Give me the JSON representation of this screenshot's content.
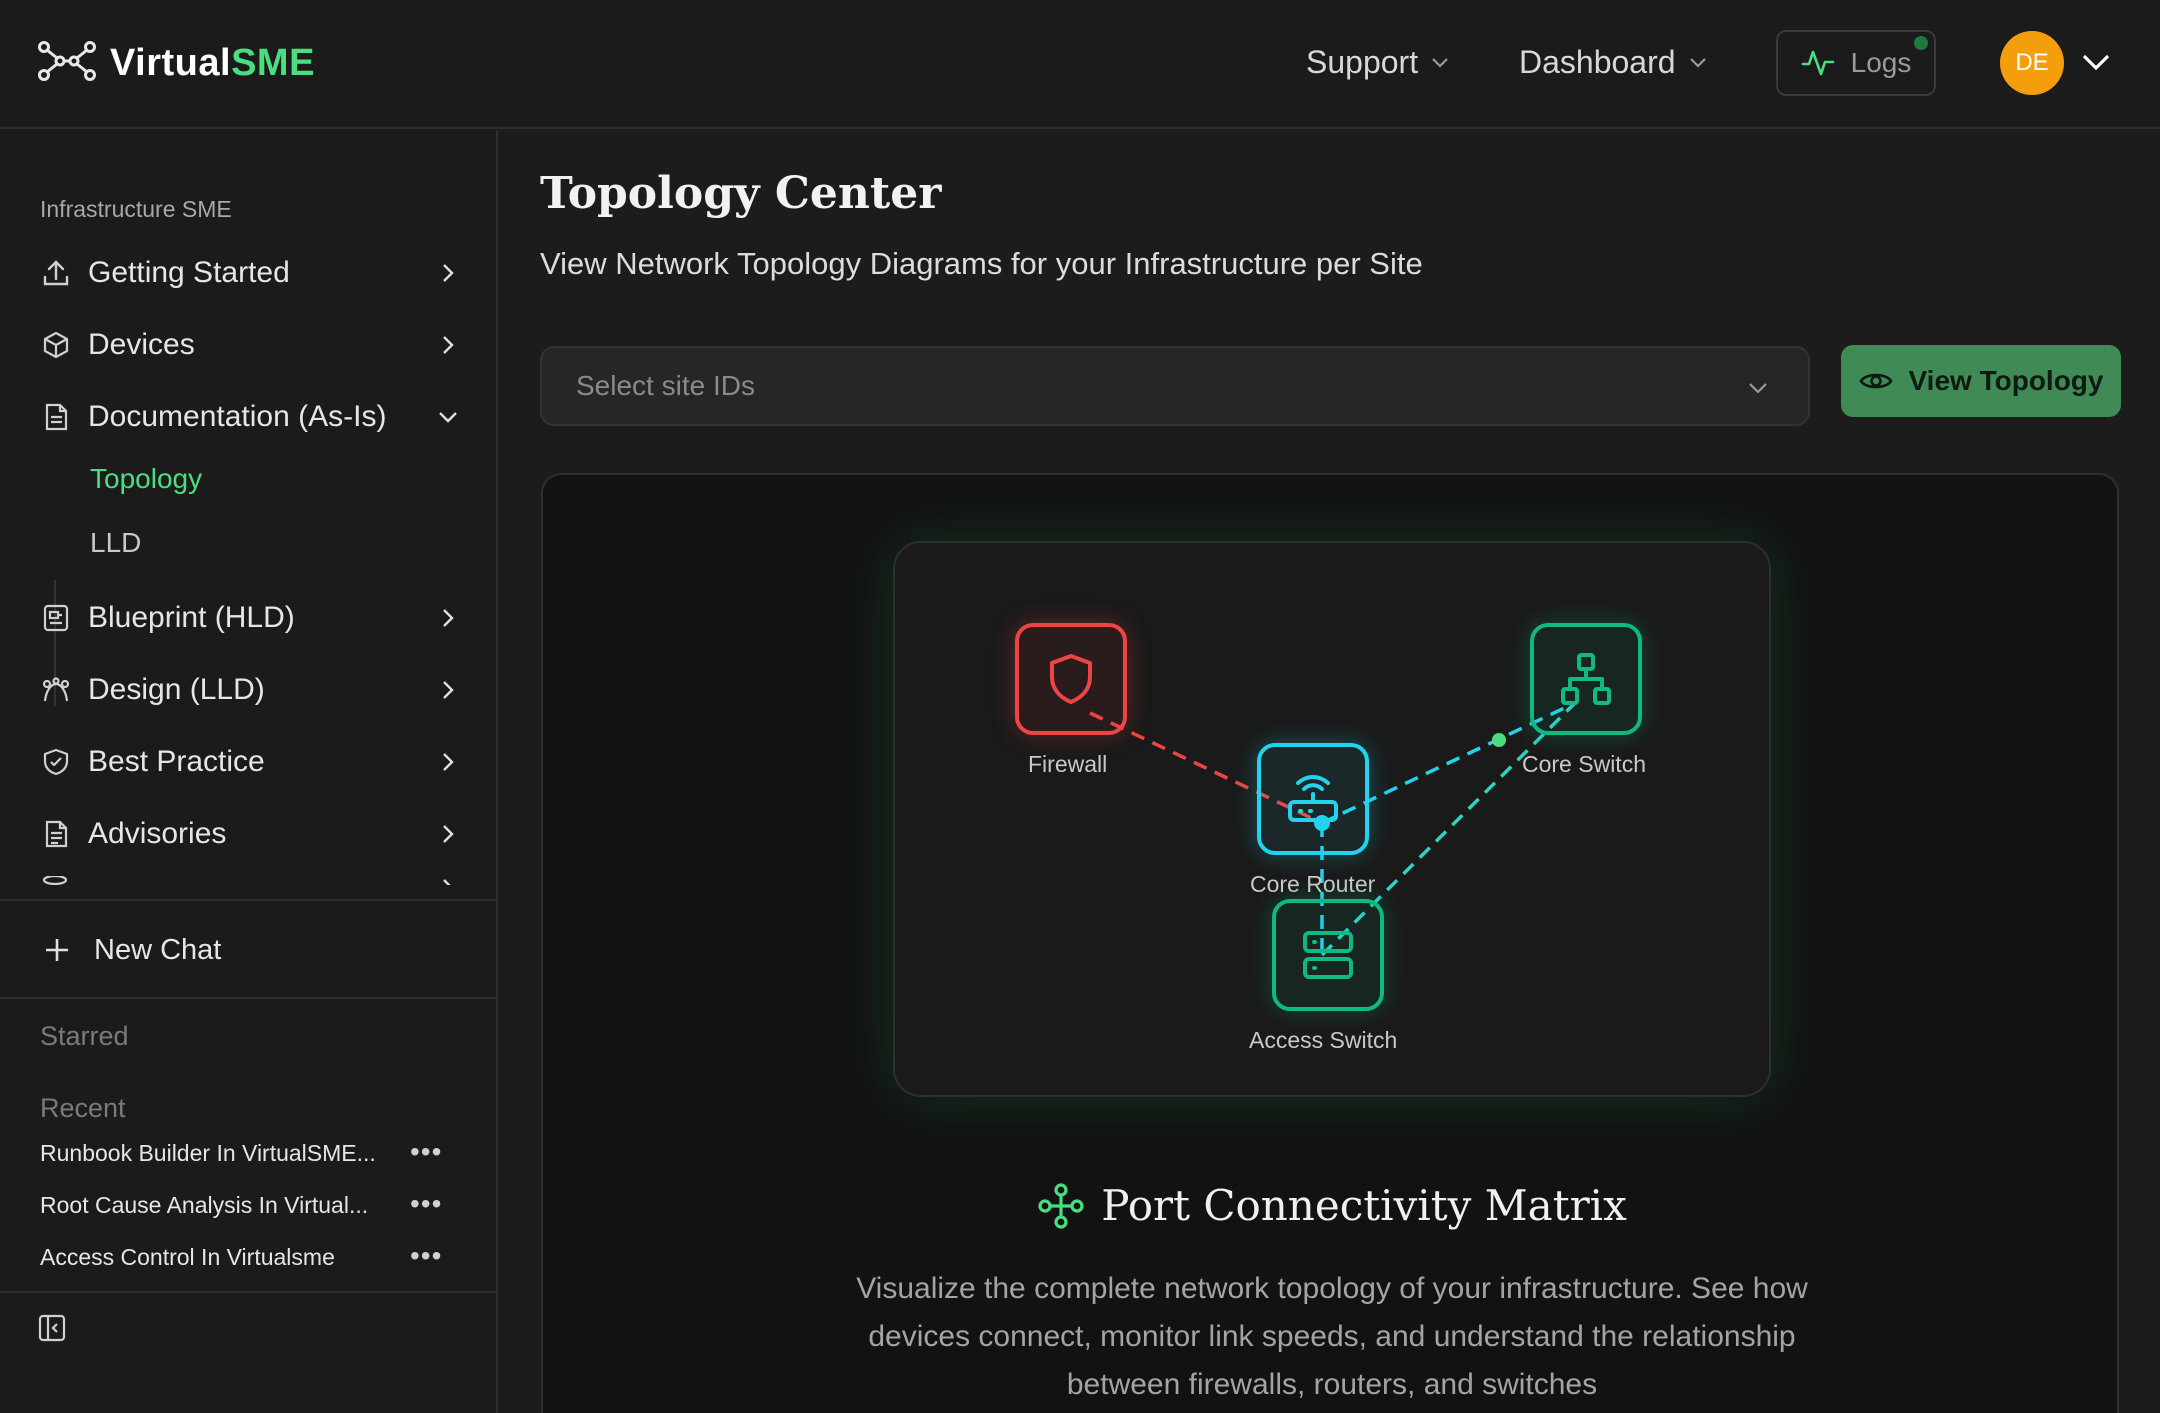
{
  "header": {
    "logo_primary": "Virtual",
    "logo_accent": "SME",
    "nav": [
      {
        "label": "Support"
      },
      {
        "label": "Dashboard"
      }
    ],
    "logs_label": "Logs",
    "avatar_initials": "DE"
  },
  "sidebar": {
    "section_title": "Infrastructure SME",
    "items": [
      {
        "label": "Getting Started",
        "icon": "upload-icon"
      },
      {
        "label": "Devices",
        "icon": "box-icon"
      },
      {
        "label": "Documentation (As-Is)",
        "icon": "document-icon",
        "expanded": true
      },
      {
        "label": "Blueprint (HLD)",
        "icon": "blueprint-icon"
      },
      {
        "label": "Design (LLD)",
        "icon": "bezier-icon"
      },
      {
        "label": "Best Practice",
        "icon": "handshake-icon"
      },
      {
        "label": "Advisories",
        "icon": "file-text-icon"
      }
    ],
    "sub_items": [
      {
        "label": "Topology",
        "active": true
      },
      {
        "label": "LLD",
        "active": false
      }
    ],
    "new_chat_label": "New Chat",
    "starred_label": "Starred",
    "recent_label": "Recent",
    "recent": [
      {
        "title": "Runbook Builder In VirtualSME..."
      },
      {
        "title": "Root Cause Analysis In Virtual..."
      },
      {
        "title": "Access Control In Virtualsme"
      }
    ]
  },
  "main": {
    "title": "Topology Center",
    "subtitle": "View Network Topology Diagrams for your Infrastructure per Site",
    "site_select_placeholder": "Select site IDs",
    "view_button_label": "View Topology",
    "diagram": {
      "nodes": [
        {
          "label": "Firewall",
          "color": "#ef4444"
        },
        {
          "label": "Core Router",
          "color": "#22d3ee"
        },
        {
          "label": "Core Switch",
          "color": "#10b981"
        },
        {
          "label": "Access Switch",
          "color": "#10b981"
        }
      ]
    },
    "connectivity_title": "Port Connectivity Matrix",
    "connectivity_description": "Visualize the complete network topology of your infrastructure. See how devices connect, monitor link speeds, and understand the relationship between firewalls, routers, and switches"
  },
  "colors": {
    "accent": "#4ade80",
    "button_bg": "#3f8a55",
    "avatar": "#f59e0b"
  }
}
